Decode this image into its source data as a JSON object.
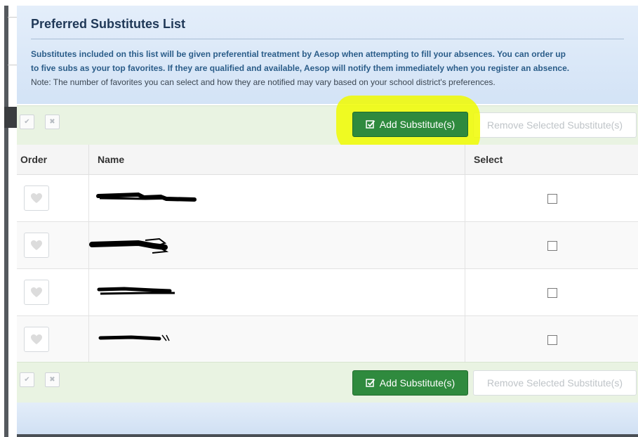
{
  "panel": {
    "title": "Preferred Substitutes List",
    "desc_line1": "Substitutes included on this list will be given preferential treatment by Aesop when attempting to fill your absences. You can order up",
    "desc_line2": "to five subs as your top favorites. If they are qualified and available, Aesop will notify them immediately when you register an absence.",
    "desc_note": "Note: The number of favorites you can select and how they are notified may vary based on your school district's preferences."
  },
  "toolbar": {
    "check_icon": "✔",
    "x_icon": "✖",
    "add_label": "Add Substitute(s)",
    "remove_label": "Remove Selected Substitute(s)"
  },
  "table": {
    "headers": {
      "order": "Order",
      "name": "Name",
      "select": "Select"
    },
    "rows": [
      {
        "name": "[redacted]",
        "selected": false
      },
      {
        "name": "[redacted]",
        "selected": false
      },
      {
        "name": "[redacted]",
        "selected": false
      },
      {
        "name": "[redacted]",
        "selected": false
      }
    ]
  },
  "colors": {
    "accent_green": "#2f8a3e",
    "highlight_yellow": "#f0fa00",
    "header_blue": "#d3e3f6",
    "toolbar_green": "#e9f3e2"
  }
}
